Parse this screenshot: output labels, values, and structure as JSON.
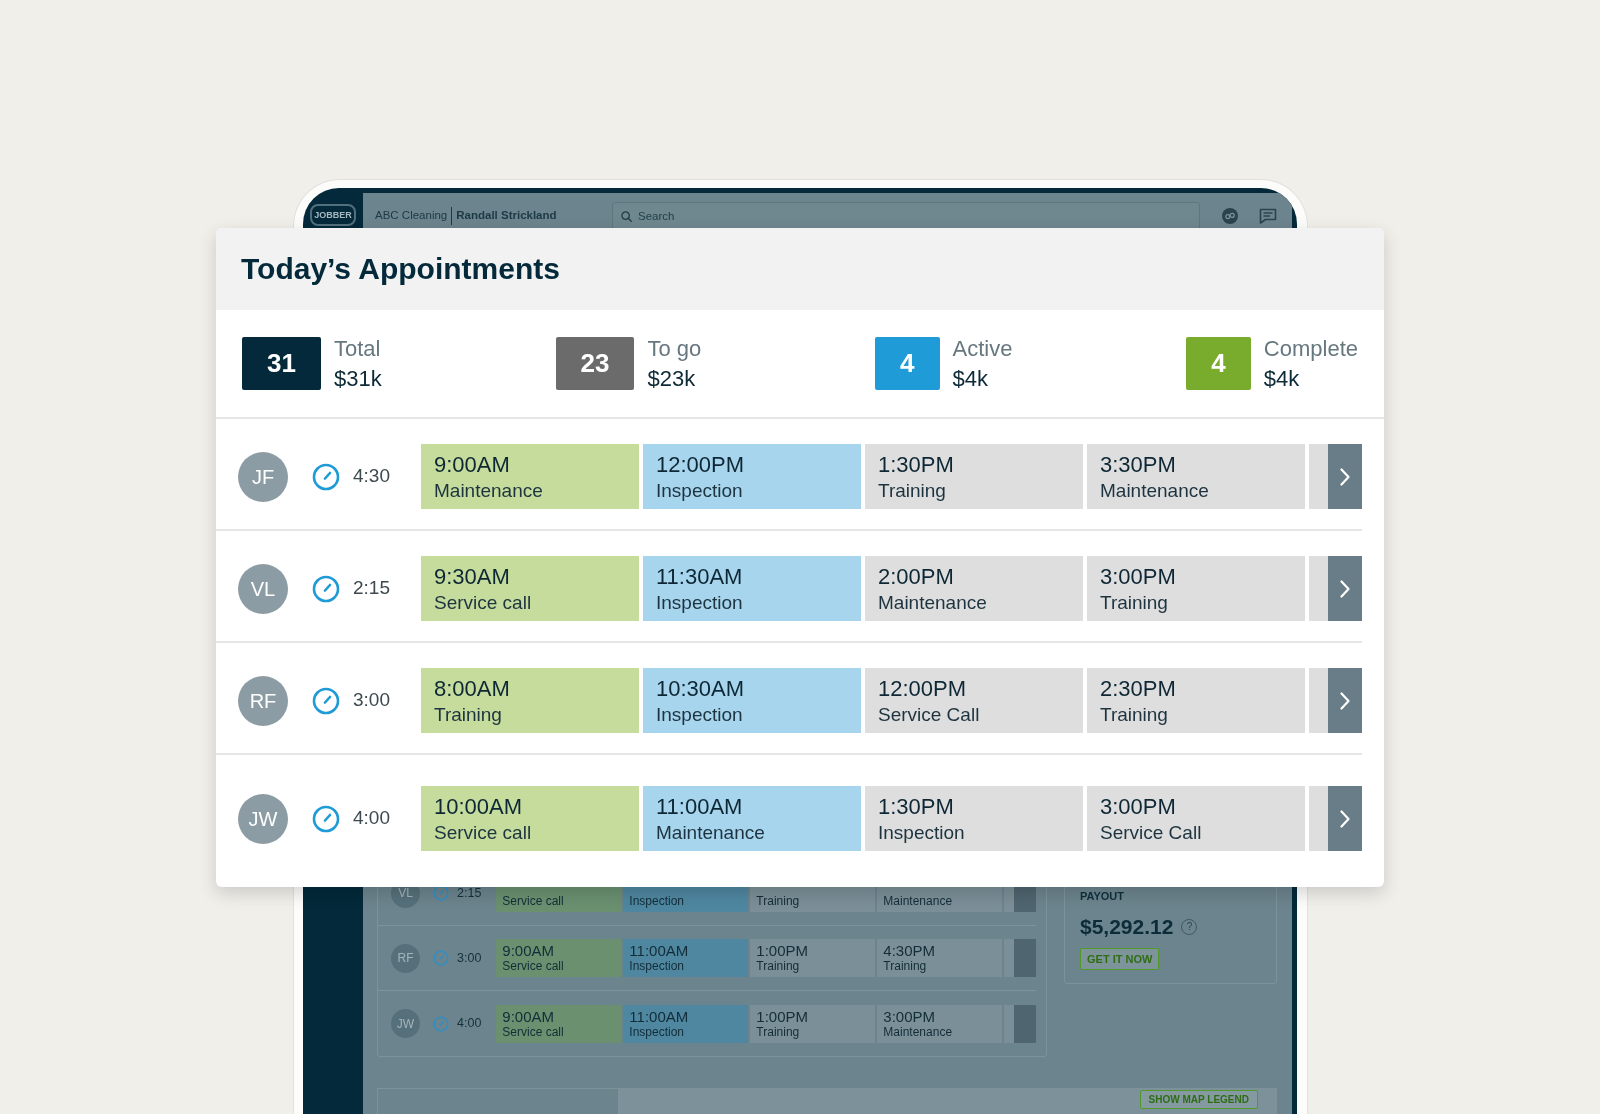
{
  "tablet": {
    "app_header": {
      "logo": "JOBBER",
      "company": "ABC Cleaning",
      "user": "Randall Strickland",
      "search": {
        "placeholder": "Search"
      }
    },
    "schedule_rows": [
      {
        "initials": "VL",
        "duration": "2:15",
        "appointments": [
          {
            "type": "Service call",
            "color": "#6a9070"
          },
          {
            "type": "Inspection",
            "color": "#4f87a0"
          },
          {
            "type": "Training",
            "color": "#7b8f98"
          },
          {
            "type": "Maintenance",
            "color": "#7b8f98"
          },
          {
            "color": "#7b8f98"
          }
        ]
      },
      {
        "initials": "RF",
        "duration": "3:00",
        "appointments": [
          {
            "time": "9:00AM",
            "type": "Service call",
            "color": "#6a9070"
          },
          {
            "time": "11:00AM",
            "type": "Inspection",
            "color": "#4f87a0"
          },
          {
            "time": "1:00PM",
            "type": "Training",
            "color": "#7b8f98"
          },
          {
            "time": "4:30PM",
            "type": "Training",
            "color": "#7b8f98"
          },
          {
            "color": "#7b8f98"
          }
        ]
      },
      {
        "initials": "JW",
        "duration": "4:00",
        "appointments": [
          {
            "time": "9:00AM",
            "type": "Service call",
            "color": "#6a9070"
          },
          {
            "time": "11:00AM",
            "type": "Inspection",
            "color": "#4f87a0"
          },
          {
            "time": "1:00PM",
            "type": "Training",
            "color": "#7b8f98"
          },
          {
            "time": "3:00PM",
            "type": "Maintenance",
            "color": "#7b8f98"
          },
          {
            "color": "#7b8f98"
          }
        ]
      }
    ],
    "payout": {
      "title": "PAYOUT",
      "amount": "$5,292.12",
      "help": "?",
      "button": "GET IT NOW"
    },
    "map": {
      "legend_button": "SHOW MAP LEGEND"
    }
  },
  "appointments_card": {
    "title": "Today’s Appointments",
    "stats": [
      {
        "count": "31",
        "label": "Total",
        "amount": "$31k",
        "color": "#03293a"
      },
      {
        "count": "23",
        "label": "To go",
        "amount": "$23k",
        "color": "#6b6b6b"
      },
      {
        "count": "4",
        "label": "Active",
        "amount": "$4k",
        "color": "#1f9bd8"
      },
      {
        "count": "4",
        "label": "Complete",
        "amount": "$4k",
        "color": "#79ab2c"
      }
    ],
    "rows": [
      {
        "initials": "JF",
        "duration": "4:30",
        "appointments": [
          {
            "time": "9:00AM",
            "type": "Maintenance",
            "color": "#c5dc9c"
          },
          {
            "time": "12:00PM",
            "type": "Inspection",
            "color": "#a7d5ed"
          },
          {
            "time": "1:30PM",
            "type": "Training",
            "color": "#dedede"
          },
          {
            "time": "3:30PM",
            "type": "Maintenance",
            "color": "#dedede"
          },
          {
            "color": "#dedede"
          }
        ]
      },
      {
        "initials": "VL",
        "duration": "2:15",
        "appointments": [
          {
            "time": "9:30AM",
            "type": "Service call",
            "color": "#c5dc9c"
          },
          {
            "time": "11:30AM",
            "type": "Inspection",
            "color": "#a7d5ed"
          },
          {
            "time": "2:00PM",
            "type": "Maintenance",
            "color": "#dedede"
          },
          {
            "time": "3:00PM",
            "type": "Training",
            "color": "#dedede"
          },
          {
            "color": "#dedede"
          }
        ]
      },
      {
        "initials": "RF",
        "duration": "3:00",
        "appointments": [
          {
            "time": "8:00AM",
            "type": "Training",
            "color": "#c5dc9c"
          },
          {
            "time": "10:30AM",
            "type": "Inspection",
            "color": "#a7d5ed"
          },
          {
            "time": "12:00PM",
            "type": "Service Call",
            "color": "#dedede"
          },
          {
            "time": "2:30PM",
            "type": "Training",
            "color": "#dedede"
          },
          {
            "color": "#dedede"
          }
        ]
      },
      {
        "initials": "JW",
        "duration": "4:00",
        "appointments": [
          {
            "time": "10:00AM",
            "type": "Service call",
            "color": "#c5dc9c"
          },
          {
            "time": "11:00AM",
            "type": "Maintenance",
            "color": "#a7d5ed"
          },
          {
            "time": "1:30PM",
            "type": "Inspection",
            "color": "#dedede"
          },
          {
            "time": "3:00PM",
            "type": "Service Call",
            "color": "#dedede"
          },
          {
            "color": "#dedede"
          }
        ]
      }
    ]
  }
}
